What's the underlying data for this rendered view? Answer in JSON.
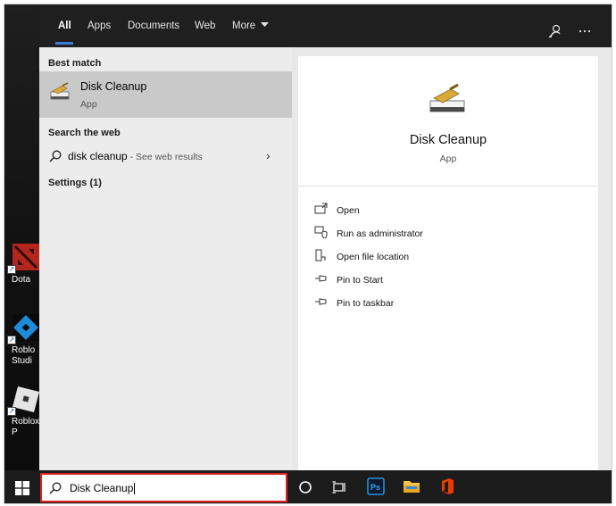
{
  "search": {
    "query": "Disk Cleanup"
  },
  "tabs": [
    {
      "label": "All"
    },
    {
      "label": "Apps"
    },
    {
      "label": "Documents"
    },
    {
      "label": "Web"
    },
    {
      "label": "More"
    }
  ],
  "left_pane": {
    "best_match_title": "Best match",
    "best_match": {
      "name": "Disk Cleanup",
      "type": "App"
    },
    "search_web_title": "Search the web",
    "web_result": {
      "query": "disk cleanup",
      "suffix": " - See web results"
    },
    "settings_title": "Settings (1)"
  },
  "detail": {
    "name": "Disk Cleanup",
    "type": "App",
    "actions": [
      {
        "label": "Open",
        "icon": "open-icon"
      },
      {
        "label": "Run as administrator",
        "icon": "shield-admin-icon"
      },
      {
        "label": "Open file location",
        "icon": "file-location-icon"
      },
      {
        "label": "Pin to Start",
        "icon": "pin-icon"
      },
      {
        "label": "Pin to taskbar",
        "icon": "pin-icon"
      }
    ]
  },
  "desktop_icons": [
    {
      "label": "Dota"
    },
    {
      "label": "Roblo Studi"
    },
    {
      "label": "Roblox P"
    }
  ],
  "taskbar_icons": [
    "windows-start-icon",
    "cortana-icon",
    "task-view-icon",
    "photoshop-icon",
    "file-explorer-icon",
    "office-icon"
  ],
  "colors": {
    "accent": "#3a7bd5",
    "highlight": "#e02020",
    "selected_row": "#c9c9c9"
  }
}
